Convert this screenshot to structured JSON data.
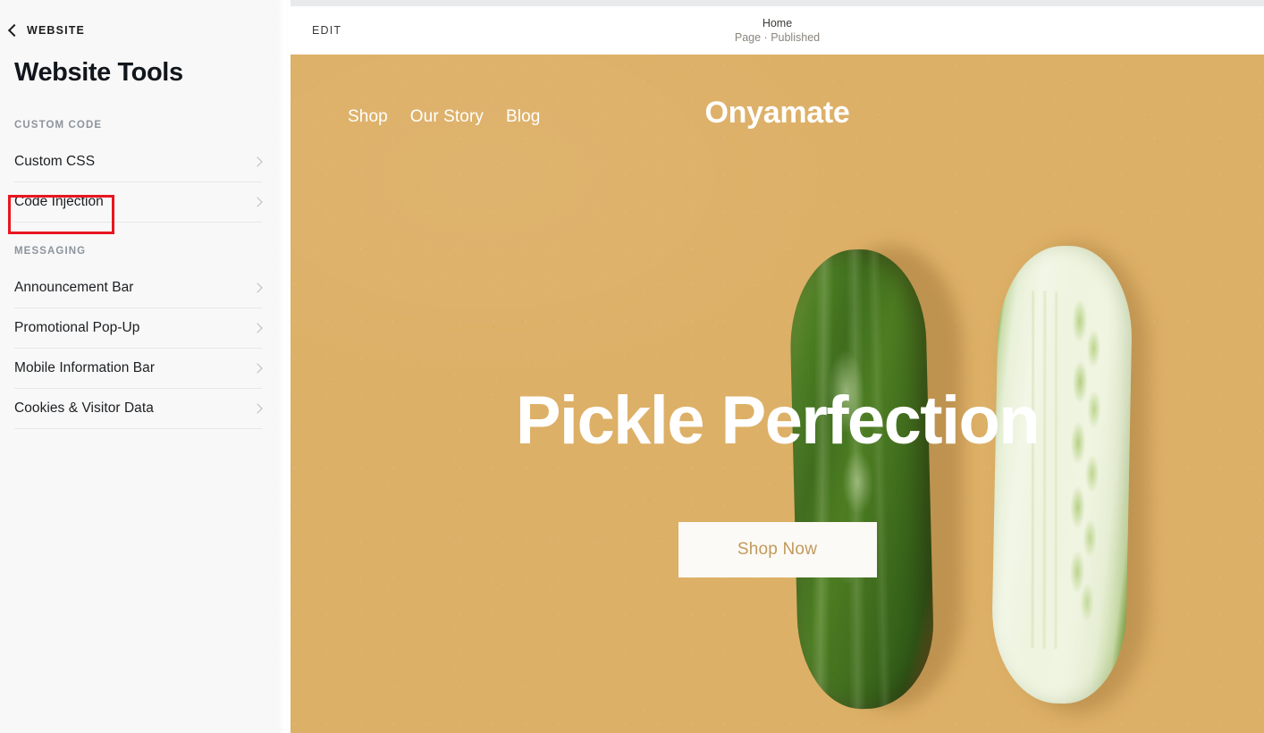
{
  "sidebar": {
    "back": {
      "label": "WEBSITE",
      "icon": "chevron-left-icon"
    },
    "title": "Website Tools",
    "groups": [
      {
        "label": "CUSTOM CODE",
        "items": [
          {
            "label": "Custom CSS",
            "icon": "chevron-right-icon"
          },
          {
            "label": "Code Injection",
            "icon": "chevron-right-icon",
            "highlighted": true
          }
        ]
      },
      {
        "label": "MESSAGING",
        "items": [
          {
            "label": "Announcement Bar",
            "icon": "chevron-right-icon"
          },
          {
            "label": "Promotional Pop-Up",
            "icon": "chevron-right-icon"
          },
          {
            "label": "Mobile Information Bar",
            "icon": "chevron-right-icon"
          },
          {
            "label": "Cookies & Visitor Data",
            "icon": "chevron-right-icon"
          }
        ]
      }
    ],
    "highlight_color": "#e8161f"
  },
  "preview": {
    "toolbar": {
      "edit_label": "EDIT",
      "page_title": "Home",
      "page_status": "Page · Published"
    },
    "site": {
      "nav": [
        {
          "label": "Shop"
        },
        {
          "label": "Our Story"
        },
        {
          "label": "Blog"
        }
      ],
      "brand": "Onyamate",
      "headline": "Pickle Perfection",
      "cta_label": "Shop Now",
      "background_color": "#ddb067",
      "cta_text_color": "#c19a5c",
      "cta_background": "#fcfaf6"
    }
  }
}
